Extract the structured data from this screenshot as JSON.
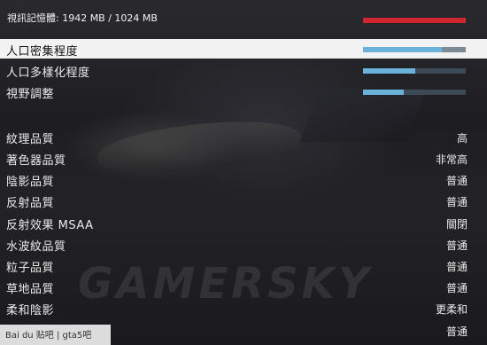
{
  "memory": {
    "label": "視訊記憶體: 1942 MB / 1024 MB"
  },
  "sliders": [
    {
      "label": "人口密集程度",
      "level_percent": 77,
      "selected": true
    },
    {
      "label": "人口多樣化程度",
      "level_percent": 51,
      "selected": false
    },
    {
      "label": "視野調整",
      "level_percent": 40,
      "selected": false
    }
  ],
  "settings": [
    {
      "label": "紋理品質",
      "value": "高"
    },
    {
      "label": "著色器品質",
      "value": "非常高"
    },
    {
      "label": "陰影品質",
      "value": "普通"
    },
    {
      "label": "反射品質",
      "value": "普通"
    },
    {
      "label": "反射效果 MSAA",
      "value": "關閉"
    },
    {
      "label": "水波紋品質",
      "value": "普通"
    },
    {
      "label": "粒子品質",
      "value": "普通"
    },
    {
      "label": "草地品質",
      "value": "普通"
    },
    {
      "label": "柔和陰影",
      "value": "更柔和"
    },
    {
      "label": "",
      "value": "普通"
    }
  ],
  "watermark": "GAMERSKY",
  "footer": "Bai du 贴吧 | gta5吧",
  "colors": {
    "memory_bar": "#d0262d",
    "slider_fill": "#6ab2d9",
    "slider_track": "#3b4a55",
    "selected_row": "#f2f2f2"
  }
}
